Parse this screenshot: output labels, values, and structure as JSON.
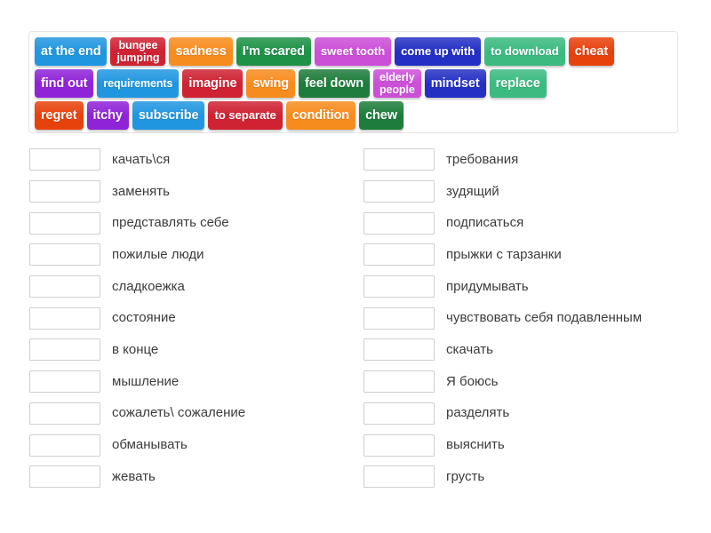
{
  "activity": {
    "type": "match-up-word-tiles",
    "language_pair": "English-Russian"
  },
  "tile_bank": {
    "rows": [
      [
        {
          "label": "at the end",
          "color": "#2196e0",
          "style": "normal"
        },
        {
          "label": "bungee\njumping",
          "color": "#cf2233",
          "style": "two-line"
        },
        {
          "label": "sadness",
          "color": "#f78c1e",
          "style": "normal"
        },
        {
          "label": "I'm scared",
          "color": "#1e9247",
          "style": "normal"
        },
        {
          "label": "sweet tooth",
          "color": "#cc4fd8",
          "style": "mid-text"
        },
        {
          "label": "come up with",
          "color": "#2430c4",
          "style": "mid-text"
        },
        {
          "label": "to download",
          "color": "#3cba80",
          "style": "mid-text"
        },
        {
          "label": "cheat",
          "color": "#e8420c",
          "style": "normal"
        }
      ],
      [
        {
          "label": "find out",
          "color": "#8f23d8",
          "style": "normal"
        },
        {
          "label": "requirements",
          "color": "#2196e0",
          "style": "small-text"
        },
        {
          "label": "imagine",
          "color": "#cf2233",
          "style": "normal"
        },
        {
          "label": "swing",
          "color": "#f78c1e",
          "style": "normal"
        },
        {
          "label": "feel down",
          "color": "#1e7d3c",
          "style": "normal"
        },
        {
          "label": "elderly\npeople",
          "color": "#cc4fd8",
          "style": "two-line"
        },
        {
          "label": "mindset",
          "color": "#2430c4",
          "style": "normal"
        },
        {
          "label": "replace",
          "color": "#3cba80",
          "style": "normal"
        }
      ],
      [
        {
          "label": "regret",
          "color": "#e8420c",
          "style": "normal"
        },
        {
          "label": "itchy",
          "color": "#8f23d8",
          "style": "normal"
        },
        {
          "label": "subscribe",
          "color": "#2196e0",
          "style": "normal"
        },
        {
          "label": "to separate",
          "color": "#cf2233",
          "style": "mid-text"
        },
        {
          "label": "condition",
          "color": "#f78c1e",
          "style": "normal"
        },
        {
          "label": "chew",
          "color": "#1e7d3c",
          "style": "normal"
        }
      ]
    ]
  },
  "answer_list": {
    "left_column": [
      {
        "slot_value": "",
        "prompt": "качать\\ся"
      },
      {
        "slot_value": "",
        "prompt": "заменять"
      },
      {
        "slot_value": "",
        "prompt": "представлять себе"
      },
      {
        "slot_value": "",
        "prompt": "пожилые люди"
      },
      {
        "slot_value": "",
        "prompt": "сладкоежка"
      },
      {
        "slot_value": "",
        "prompt": "состояние"
      },
      {
        "slot_value": "",
        "prompt": "в конце"
      },
      {
        "slot_value": "",
        "prompt": "мышление"
      },
      {
        "slot_value": "",
        "prompt": "сожалеть\\ сожаление"
      },
      {
        "slot_value": "",
        "prompt": "обманывать"
      },
      {
        "slot_value": "",
        "prompt": "жевать"
      }
    ],
    "right_column": [
      {
        "slot_value": "",
        "prompt": "требования"
      },
      {
        "slot_value": "",
        "prompt": "зудящий"
      },
      {
        "slot_value": "",
        "prompt": "подписаться"
      },
      {
        "slot_value": "",
        "prompt": "прыжки с тарзанки"
      },
      {
        "slot_value": "",
        "prompt": "придумывать"
      },
      {
        "slot_value": "",
        "prompt": "чувствовать себя подавленным"
      },
      {
        "slot_value": "",
        "prompt": "скачать"
      },
      {
        "slot_value": "",
        "prompt": "Я боюсь"
      },
      {
        "slot_value": "",
        "prompt": "разделять"
      },
      {
        "slot_value": "",
        "prompt": "выяснить"
      },
      {
        "slot_value": "",
        "prompt": "грусть"
      }
    ]
  },
  "colors": {
    "tile_blue": "#2196e0",
    "tile_red": "#cf2233",
    "tile_orange": "#f78c1e",
    "tile_green": "#1e9247",
    "tile_magenta": "#cc4fd8",
    "tile_indigo": "#2430c4",
    "tile_mint": "#3cba80",
    "tile_vermilion": "#e8420c",
    "tile_purple": "#8f23d8",
    "tile_darkgreen": "#1e7d3c",
    "slot_border": "#cfcfcf",
    "bank_border": "#e3e3e3",
    "text_color": "#3c3c3c",
    "page_background": "#ffffff"
  }
}
